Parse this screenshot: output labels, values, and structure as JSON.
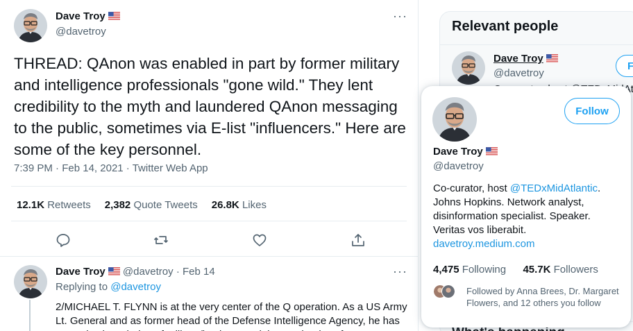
{
  "tweet": {
    "author_name": "Dave Troy",
    "author_handle": "@davetroy",
    "text": "THREAD: QAnon was enabled in part by former military and intelligence professionals \"gone wild.\" They lent credibility to the myth and laundered QAnon messaging to the public, sometimes via E-list \"influencers.\" Here are some of the key personnel.",
    "time": "7:39 PM",
    "date": "Feb 14, 2021",
    "source": "Twitter Web App",
    "retweets_count": "12.1K",
    "retweets_label": "Retweets",
    "quotes_count": "2,382",
    "quotes_label": "Quote Tweets",
    "likes_count": "26.8K",
    "likes_label": "Likes"
  },
  "reply": {
    "author_name": "Dave Troy",
    "author_handle": "@davetroy",
    "date": "Feb 14",
    "replying_to_label": "Replying to",
    "replying_to_handle": "@davetroy",
    "text": "2/MICHAEL T. FLYNN is at the very center of the Q operation. As a US Army Lt. General and as former head of the Defense Intelligence Agency, he has extensive knowledge of military/intel ops and the mechanics of"
  },
  "sidebar": {
    "title": "Relevant people",
    "person_name": "Dave Troy",
    "person_handle": "@davetroy",
    "follow_label": "F",
    "bio_fragment": "Co-curator, host @TEDxMidAtlantic",
    "bottom_fragment": "What's happening"
  },
  "hovercard": {
    "name": "Dave Troy",
    "handle": "@davetroy",
    "follow_label": "Follow",
    "bio_before": "Co-curator, host ",
    "bio_mention": "@TEDxMidAtlantic",
    "bio_after": ". Johns Hopkins. Network analyst, disinformation specialist. Speaker. Veritas vos liberabit.",
    "website": "davetroy.medium.com",
    "following_count": "4,475",
    "following_label": "Following",
    "followers_count": "45.7K",
    "followers_label": "Followers",
    "followed_by": "Followed by Anna Brees, Dr. Margaret Flowers, and 12 others you follow"
  },
  "colors": {
    "accent": "#1da1f2",
    "link": "#1b95e0",
    "muted": "#536471"
  },
  "icons": [
    "flag-us-icon",
    "more-icon",
    "reply-icon",
    "retweet-icon",
    "like-icon",
    "share-icon"
  ]
}
